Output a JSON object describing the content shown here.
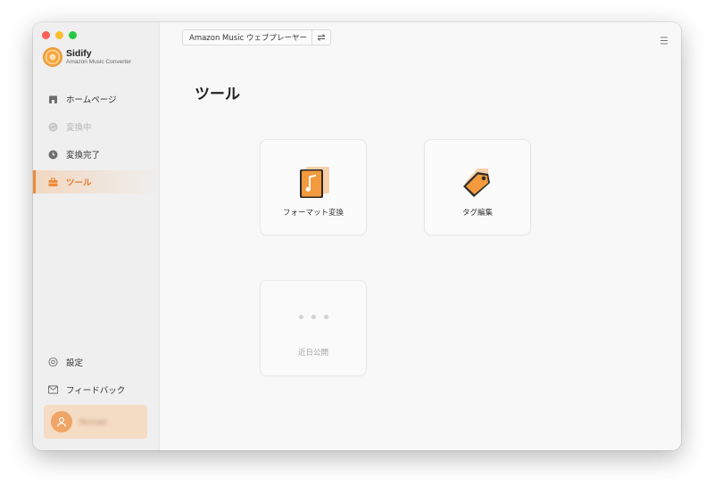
{
  "brand": {
    "name": "Sidify",
    "subtitle": "Amazon Music Converter"
  },
  "nav": {
    "items": [
      {
        "label": "ホームページ",
        "icon": "home-icon",
        "state": "normal"
      },
      {
        "label": "変換中",
        "icon": "converting-icon",
        "state": "disabled"
      },
      {
        "label": "変換完了",
        "icon": "clock-icon",
        "state": "normal"
      },
      {
        "label": "ツール",
        "icon": "toolbox-icon",
        "state": "active"
      }
    ],
    "bottom": [
      {
        "label": "設定",
        "icon": "gear-icon"
      },
      {
        "label": "フィードバック",
        "icon": "mail-icon"
      }
    ]
  },
  "user": {
    "name": "Michael"
  },
  "header": {
    "source_label": "Amazon Music ウェブプレーヤー",
    "swap_icon": "swap-icon",
    "menu_icon": "menu-icon"
  },
  "page": {
    "title": "ツール"
  },
  "tools": [
    {
      "label": "フォーマット変換",
      "icon": "music-file-icon"
    },
    {
      "label": "タグ編集",
      "icon": "tag-icon"
    },
    {
      "label": "近日公開",
      "icon": "dots-icon"
    }
  ],
  "colors": {
    "accent": "#ee8a3a",
    "active_text": "#e27a28",
    "user_card": "#f5dcc4"
  }
}
